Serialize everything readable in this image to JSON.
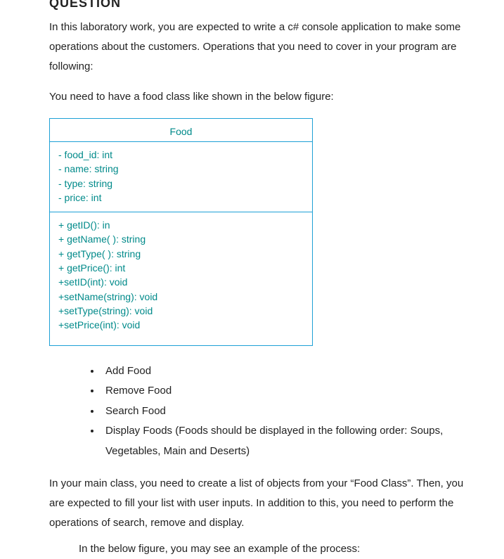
{
  "partialHeading": "QUESTION",
  "para1": "In this laboratory work, you are expected to write a c# console application to make some operations about the customers. Operations that you need to cover in your program are following:",
  "para2": "You need to have a food class like shown in the below figure:",
  "uml": {
    "title": "Food",
    "attributes": [
      "- food_id:  int",
      "- name: string",
      "- type: string",
      "- price: int"
    ],
    "methods": [
      "+ getID():  in",
      "+ getName(  ): string",
      "+ getType(  ): string",
      "+ getPrice():  int",
      "+setID(int):  void",
      "+setName(string):  void",
      "+setType(string):  void",
      "+setPrice(int):  void"
    ]
  },
  "operations": [
    "Add Food",
    "Remove Food",
    "Search Food",
    "Display Foods (Foods should be displayed in the following order: Soups, Vegetables, Main and Deserts)"
  ],
  "para3": "In your main class, you need to create a list of objects from your “Food Class”. Then, you are expected to fill your list with user inputs. In addition to this, you need to perform the operations of search, remove and display.",
  "para4": "In the below figure, you may see an example of the process:"
}
